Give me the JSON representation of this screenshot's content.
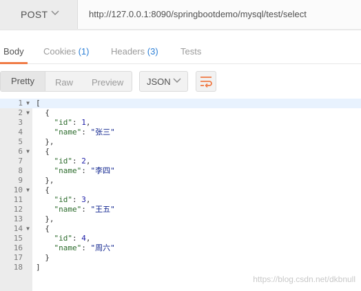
{
  "request": {
    "method": "POST",
    "url": "http://127.0.0.1:8090/springbootdemo/mysql/test/select"
  },
  "tabs": [
    {
      "label": "Body",
      "count": ""
    },
    {
      "label": "Cookies",
      "count": "(1)"
    },
    {
      "label": "Headers",
      "count": "(3)"
    },
    {
      "label": "Tests",
      "count": ""
    }
  ],
  "view_modes": [
    "Pretty",
    "Raw",
    "Preview"
  ],
  "format": "JSON",
  "line_numbers": [
    "1",
    "2",
    "3",
    "4",
    "5",
    "6",
    "7",
    "8",
    "9",
    "10",
    "11",
    "12",
    "13",
    "14",
    "15",
    "16",
    "17",
    "18"
  ],
  "code": {
    "open_bracket": "[",
    "close_bracket": "]",
    "open_brace": "{",
    "close_brace": "},",
    "last_close_brace": "}",
    "id_key": "\"id\"",
    "name_key": "\"name\"",
    "records": [
      {
        "id": "1",
        "name": "\"张三\""
      },
      {
        "id": "2",
        "name": "\"李四\""
      },
      {
        "id": "3",
        "name": "\"王五\""
      },
      {
        "id": "4",
        "name": "\"周六\""
      }
    ]
  },
  "watermark": "https://blog.csdn.net/dkbnull",
  "colors": {
    "accent": "#f07b46",
    "count": "#2c7fd6",
    "gutter": "#ececec"
  }
}
